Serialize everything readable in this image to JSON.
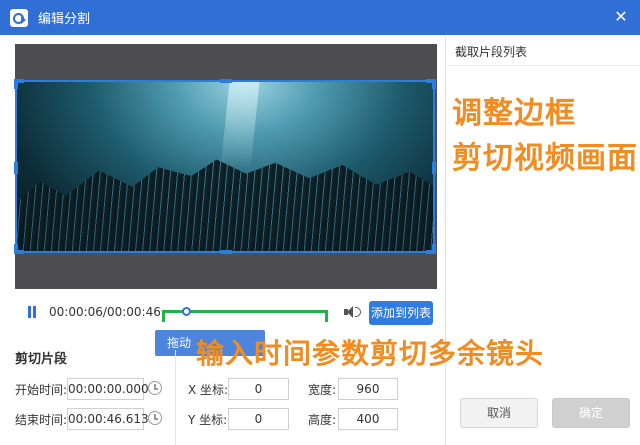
{
  "window": {
    "title": "编辑分割"
  },
  "player": {
    "time": "00:00:06/00:00:46",
    "add_to_list_label": "添加到列表",
    "drag_tip": "拖动"
  },
  "clip_list": {
    "title": "截取片段列表"
  },
  "clip_settings": {
    "title": "剪切片段",
    "start_label": "开始时间:",
    "start_value": "00:00:00.000",
    "end_label": "结束时间:",
    "end_value": "00:00:46.613",
    "x_label": "X 坐标:",
    "x_value": "0",
    "y_label": "Y 坐标:",
    "y_value": "0",
    "width_label": "宽度:",
    "width_value": "960",
    "height_label": "高度:",
    "height_value": "400"
  },
  "dialog_buttons": {
    "cancel": "取消",
    "confirm": "确定"
  },
  "annotations": {
    "line1": "调整边框",
    "line2": "剪切视频画面",
    "line3": "输入时间参数剪切多余镜头"
  },
  "colors": {
    "accent": "#2f6fd6",
    "timeline": "#24b14a",
    "annotation": "#f08c20"
  }
}
